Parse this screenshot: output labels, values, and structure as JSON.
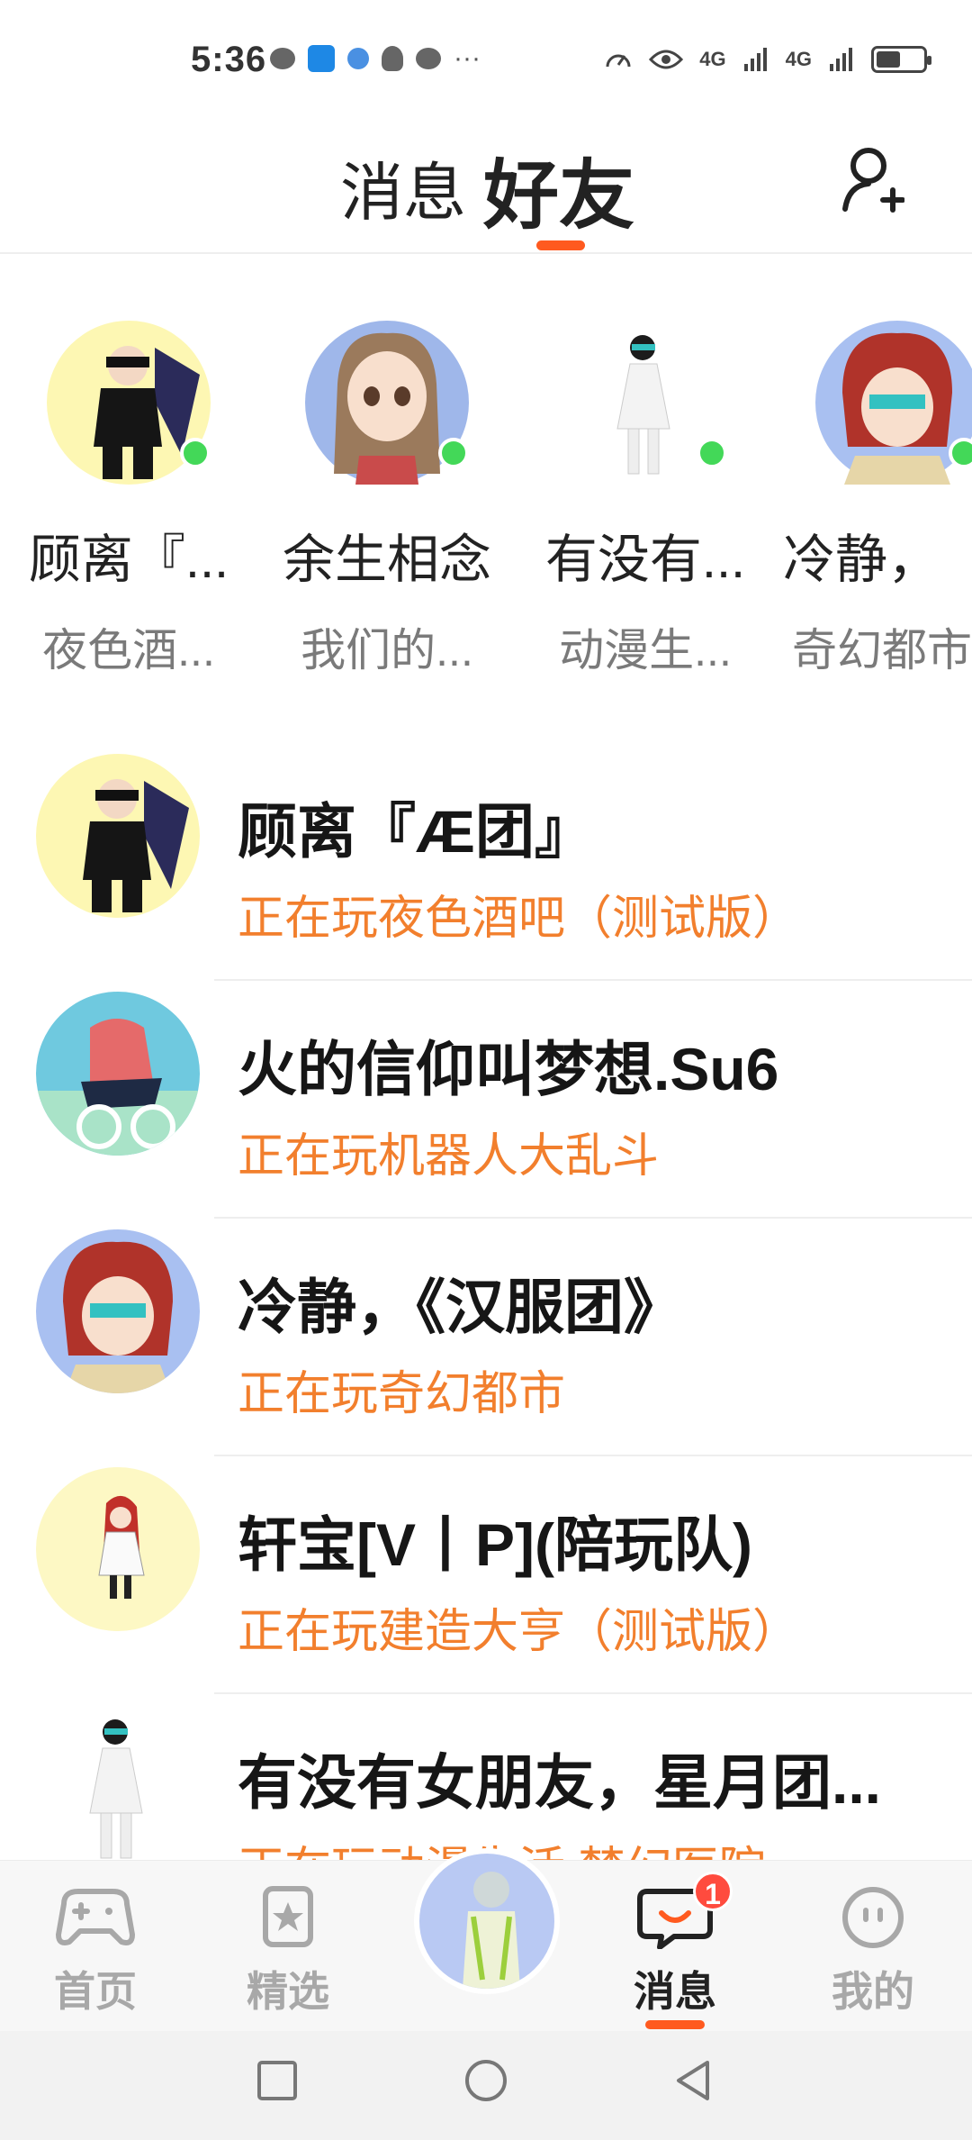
{
  "status_bar": {
    "time": "5:36",
    "network_left": "4G",
    "network_right": "4G",
    "more_dots": "···"
  },
  "header": {
    "tab_messages": "消息",
    "tab_friends": "好友",
    "active_tab": "好友",
    "accent_color": "#ff5a1f"
  },
  "online_friends": [
    {
      "name": "顾离『...",
      "game": "夜色酒...",
      "online": true,
      "avatar_bg": "#fdf7b3"
    },
    {
      "name": "余生相念",
      "game": "我们的...",
      "online": true,
      "avatar_bg": "#9fb7ea"
    },
    {
      "name": "有没有...",
      "game": "动漫生...",
      "online": true,
      "avatar_bg": "#ffffff"
    },
    {
      "name": "冷静，",
      "game": "奇幻都市",
      "online": true,
      "avatar_bg": "#a9c0f1"
    }
  ],
  "friends": [
    {
      "name": "顾离『Æ团』",
      "status": "正在玩夜色酒吧（测试版）",
      "avatar_bg": "#fdf7b3"
    },
    {
      "name": "火的信仰叫梦想.Su6",
      "status": "正在玩机器人大乱斗",
      "avatar_bg": "#6fc9df"
    },
    {
      "name": "冷静，《汉服团》",
      "status": "正在玩奇幻都市",
      "avatar_bg": "#a9c0f1"
    },
    {
      "name": "轩宝[V丨P](陪玩队)",
      "status": "正在玩建造大亨（测试版）",
      "avatar_bg": "#fdf8c4"
    },
    {
      "name": "有没有女朋友，星月团...",
      "status": "正在玩动漫生活:梦幻医院",
      "avatar_bg": "#ffffff"
    }
  ],
  "bottom_nav": {
    "home": "首页",
    "featured": "精选",
    "messages": "消息",
    "mine": "我的",
    "messages_badge": "1",
    "active": "消息"
  }
}
